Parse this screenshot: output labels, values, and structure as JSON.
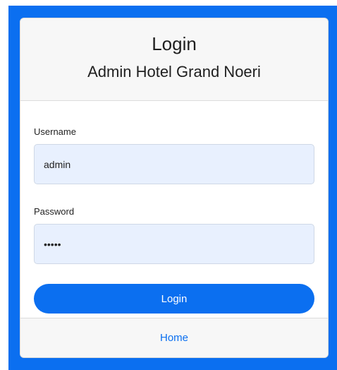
{
  "header": {
    "title": "Login",
    "subtitle": "Admin Hotel Grand Noeri"
  },
  "form": {
    "username": {
      "label": "Username",
      "value": "admin"
    },
    "password": {
      "label": "Password",
      "value": "admin"
    },
    "submit_label": "Login"
  },
  "footer": {
    "home_label": "Home"
  },
  "colors": {
    "accent": "#0b6ff0",
    "input_bg": "#e8f0fe",
    "header_bg": "#f7f7f7"
  }
}
